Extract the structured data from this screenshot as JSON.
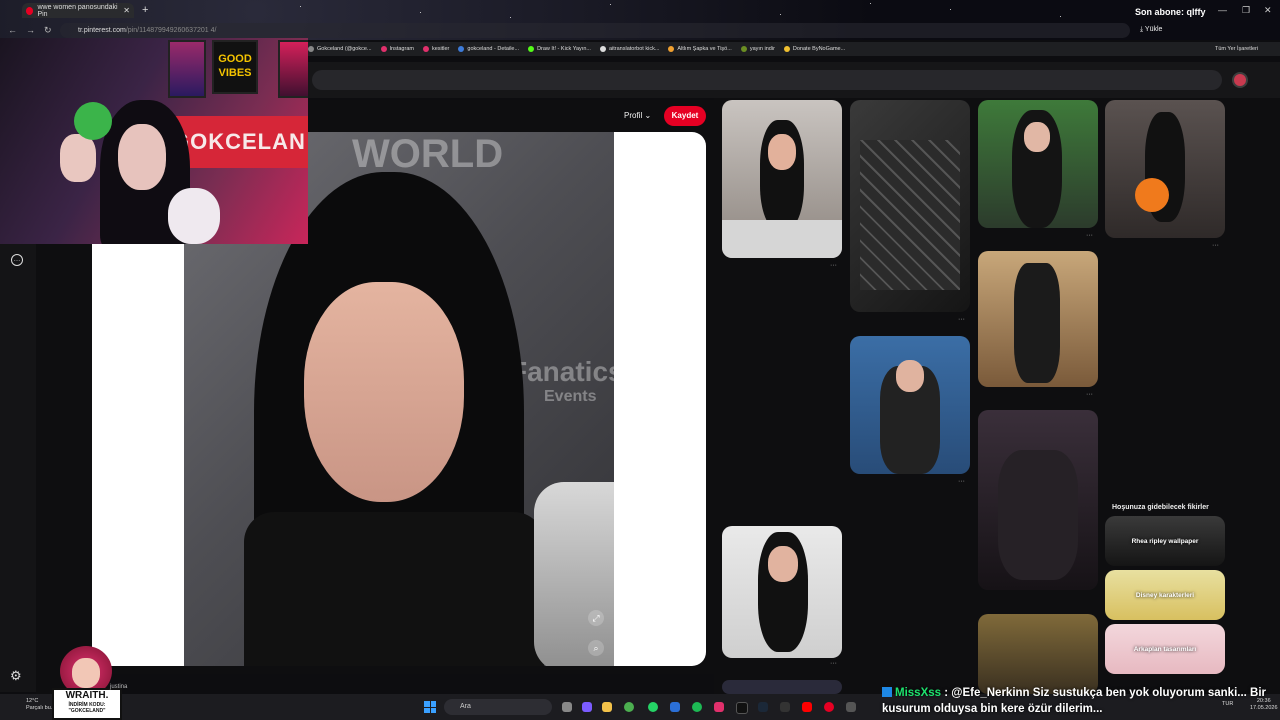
{
  "browser": {
    "tab_title": "wwe women panosundaki Pin",
    "new_tab": "+",
    "url_domain": "tr.pinterest.com",
    "url_path": "/pin/114879949260637201 4/",
    "upload_label": "Yükle",
    "all_bookmarks": "Tüm Yer İşaretleri",
    "bookmarks": [
      {
        "label": "Gokceland (@gokce...",
        "color": "#888888"
      },
      {
        "label": "Instagram",
        "color": "#e1306c"
      },
      {
        "label": "kesitler",
        "color": "#e1306c"
      },
      {
        "label": "gokceland - Detaile...",
        "color": "#3d7bd9"
      },
      {
        "label": "Draw It! - Kick Yayın...",
        "color": "#53fc18"
      },
      {
        "label": "aitranslatorbot kick...",
        "color": "#dddddd"
      },
      {
        "label": "Altlım Şapka ve Tişö...",
        "color": "#f0a030"
      },
      {
        "label": "yayın indir",
        "color": "#6b8e23"
      },
      {
        "label": "Donate ByNoGame...",
        "color": "#f0c030"
      }
    ]
  },
  "overlay": {
    "subscriber": "Son abone: qlffy",
    "webcam_sign": "GOKCELAN",
    "poster_text": "GOOD VIBES",
    "wraith_name": "WRAITH.",
    "wraith_code": "İNDİRİM KODU: \"GOKCELAND\"",
    "justina": "justina",
    "chat_user": "MissXss",
    "chat_text": " : @Efe_Nerkinn Siz sustukça ben yok oluyorum sanki... Bir kusurum olduysa bin kere özür dilerim..."
  },
  "pin": {
    "profile_label": "Profil",
    "save_label": "Kaydet",
    "watermark_1": "WORLD",
    "watermark_2": "Fanatics",
    "watermark_3": "Events"
  },
  "ideas": {
    "title": "Hoşunuza gidebilecek fikirler",
    "items": [
      "Rhea ripley wallpaper",
      "Disney karakterleri",
      "Arkaplan tasarımları"
    ]
  },
  "taskbar": {
    "weather_temp": "12°C",
    "weather_desc": "Parçalı bu...",
    "search_placeholder": "Ara",
    "lang": "TUR",
    "time": "20:36",
    "date": "17.05.2026"
  }
}
